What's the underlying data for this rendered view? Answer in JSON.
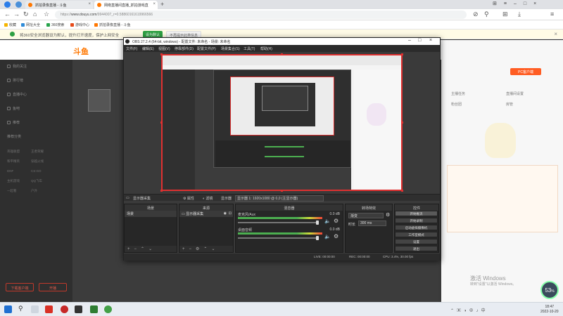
{
  "tabs": [
    {
      "label": "抓拍录像直播 - 斗鱼",
      "active": false
    },
    {
      "label": "网络直播间直播_抓拍游戏直",
      "active": true
    }
  ],
  "address": {
    "protocol": "https://",
    "host": "www.douyu.com",
    "path": "/9944007_r=0.58860161619966566"
  },
  "bookmarks": [
    "收藏",
    "网址大全",
    "360搜索",
    "游戏中心",
    "抓拍录像直播 - 斗鱼"
  ],
  "notice": {
    "text": "将360安全浏览器设为默认，提升打开速度，保护上网安全",
    "ok": "设为默认",
    "no": "不再提示此类信息"
  },
  "site": {
    "logo": "斗鱼"
  },
  "leftnav": {
    "items": [
      "我的关注",
      "排行榜",
      "直播中心",
      "鱼吧",
      "推荐",
      "推荐分类"
    ],
    "grid": [
      [
        "英雄联盟",
        "王者荣耀"
      ],
      [
        "和平精英",
        "穿越火线"
      ],
      [
        "DNF",
        "CS:GO"
      ],
      [
        "主机游戏",
        "QQ飞车"
      ],
      [
        "一起看",
        "户外"
      ]
    ],
    "buttons": [
      "下载客户端",
      "开播"
    ]
  },
  "rightside": {
    "buttons": [
      "PC客户端",
      "主播任务",
      "直播间设置",
      "粉丝团",
      "房管"
    ]
  },
  "obs": {
    "title": "OBS 27.2.4 (64-bit, windows) - 配置文件: 未命名 - 场景: 未命名",
    "menu": [
      "文件(F)",
      "编辑(E)",
      "视图(V)",
      "停靠部件(D)",
      "配置文件(P)",
      "场景集合(S)",
      "工具(T)",
      "帮助(H)"
    ],
    "context": {
      "source": "显示器采集",
      "props": "属性",
      "filters": "滤镜",
      "display": "显示器",
      "res": "显示器 1: 1920x1080 @ 0,0 (主显示器)"
    },
    "docks": {
      "scenes": "场景",
      "sources": "来源",
      "mixer": "混音器",
      "transitions": "转场特效",
      "controls": "控件"
    },
    "scene_item": "场景",
    "source_item": "显示器采集",
    "mixer": [
      {
        "name": "麦克风/Aux",
        "db": "0.0 dB"
      },
      {
        "name": "桌面音频",
        "db": "0.0 dB"
      }
    ],
    "transition": {
      "type": "渐变",
      "duration_label": "时长",
      "duration": "300 ms"
    },
    "controls": [
      "开始推流",
      "开始录制",
      "启动虚拟摄像机",
      "工作室模式",
      "设置",
      "退出"
    ],
    "status": {
      "live": "LIVE: 00:00:00",
      "rec": "REC: 00:00:00",
      "cpu": "CPU: 3.4%, 30.00 fps"
    }
  },
  "taskbar": {
    "time": "18:47",
    "date": "2022-10-20"
  },
  "speed": {
    "value": "53",
    "unit": "%"
  },
  "watermark": {
    "line1": "激活 Windows",
    "line2": "转到\"设置\"以激活 Windows。"
  }
}
